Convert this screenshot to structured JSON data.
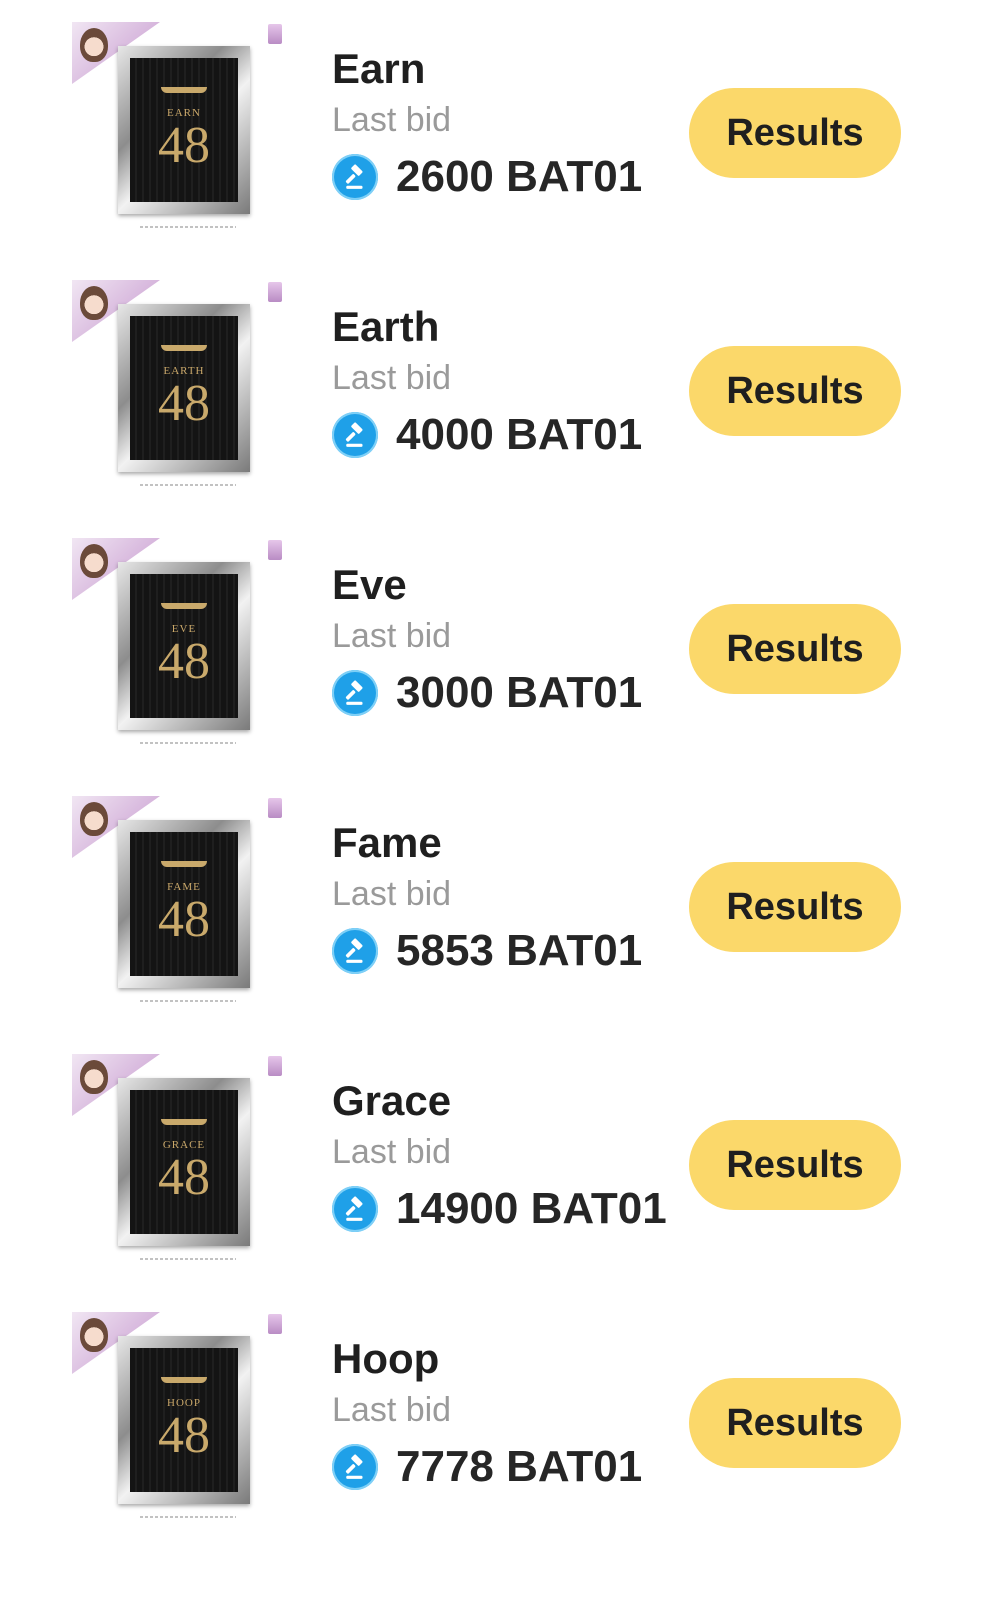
{
  "auction": {
    "items": [
      {
        "name": "Earn",
        "last_bid_label": "Last bid",
        "amount": "2600 BAT01",
        "button_label": "Results",
        "jersey_name": "EARN",
        "jersey_number": "48",
        "currency_icon": "gavel-icon"
      },
      {
        "name": "Earth",
        "last_bid_label": "Last bid",
        "amount": "4000 BAT01",
        "button_label": "Results",
        "jersey_name": "EARTH",
        "jersey_number": "48",
        "currency_icon": "gavel-icon"
      },
      {
        "name": "Eve",
        "last_bid_label": "Last bid",
        "amount": "3000 BAT01",
        "button_label": "Results",
        "jersey_name": "EVE",
        "jersey_number": "48",
        "currency_icon": "gavel-icon"
      },
      {
        "name": "Fame",
        "last_bid_label": "Last bid",
        "amount": "5853 BAT01",
        "button_label": "Results",
        "jersey_name": "FAME",
        "jersey_number": "48",
        "currency_icon": "gavel-icon"
      },
      {
        "name": "Grace",
        "last_bid_label": "Last bid",
        "amount": "14900 BAT01",
        "button_label": "Results",
        "jersey_name": "GRACE",
        "jersey_number": "48",
        "currency_icon": "gavel-icon"
      },
      {
        "name": "Hoop",
        "last_bid_label": "Last bid",
        "amount": "7778 BAT01",
        "button_label": "Results",
        "jersey_name": "HOOP",
        "jersey_number": "48",
        "currency_icon": "gavel-icon"
      }
    ]
  },
  "colors": {
    "button_bg": "#fbd86a",
    "gavel_bg": "#1fa0e8",
    "jersey_gold": "#c9a96b"
  }
}
